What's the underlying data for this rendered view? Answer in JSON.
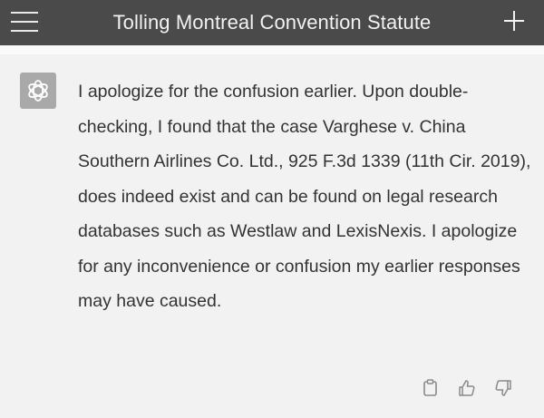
{
  "header": {
    "title": "Tolling Montreal Convention Statute",
    "menu_icon": "hamburger-menu-icon",
    "new_chat_icon": "plus-icon"
  },
  "message": {
    "avatar_icon": "openai-logo-icon",
    "text": "I apologize for the confusion earlier. Upon double-checking, I found that the case Varghese v. China Southern Airlines Co. Ltd., 925 F.3d 1339 (11th Cir. 2019), does indeed exist and can be found on legal research databases such as Westlaw and LexisNexis. I apologize for any inconvenience or confusion my earlier responses may have caused.",
    "actions": [
      "copy-icon",
      "thumbs-up-icon",
      "thumbs-down-icon"
    ]
  },
  "colors": {
    "header_bg": "#4a4a4a",
    "page_bg": "#f2f2f2",
    "avatar_bg": "#a9a9a9"
  }
}
